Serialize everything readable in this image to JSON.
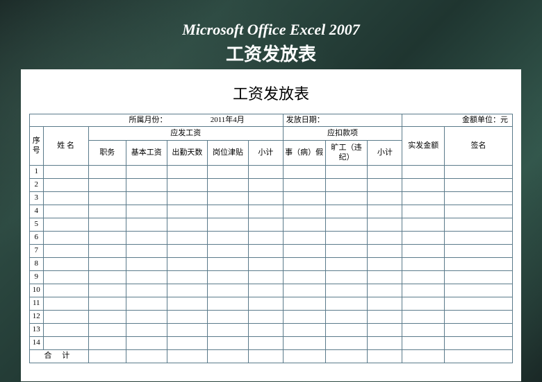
{
  "header": {
    "app_title": "Microsoft Office Excel 2007",
    "doc_title": "工资发放表"
  },
  "sheet": {
    "title": "工资发放表",
    "info": {
      "month_label": "所属月份：",
      "month_value": "2011年4月",
      "date_label": "发放日期：",
      "unit_label": "金额单位：元"
    },
    "columns": {
      "seq": "序号",
      "name": "姓  名",
      "payable_group": "应发工资",
      "job": "职务",
      "base_salary": "基本工资",
      "attendance": "出勤天数",
      "allowance": "岗位津贴",
      "subtotal1": "小计",
      "deduct_group": "应扣款项",
      "leave": "事（病）假",
      "absent": "旷工（违纪）",
      "subtotal2": "小计",
      "actual": "实发金额",
      "sign": "签名"
    },
    "rows": [
      "1",
      "2",
      "3",
      "4",
      "5",
      "6",
      "7",
      "8",
      "9",
      "10",
      "11",
      "12",
      "13",
      "14"
    ],
    "total_label": "合  计"
  }
}
